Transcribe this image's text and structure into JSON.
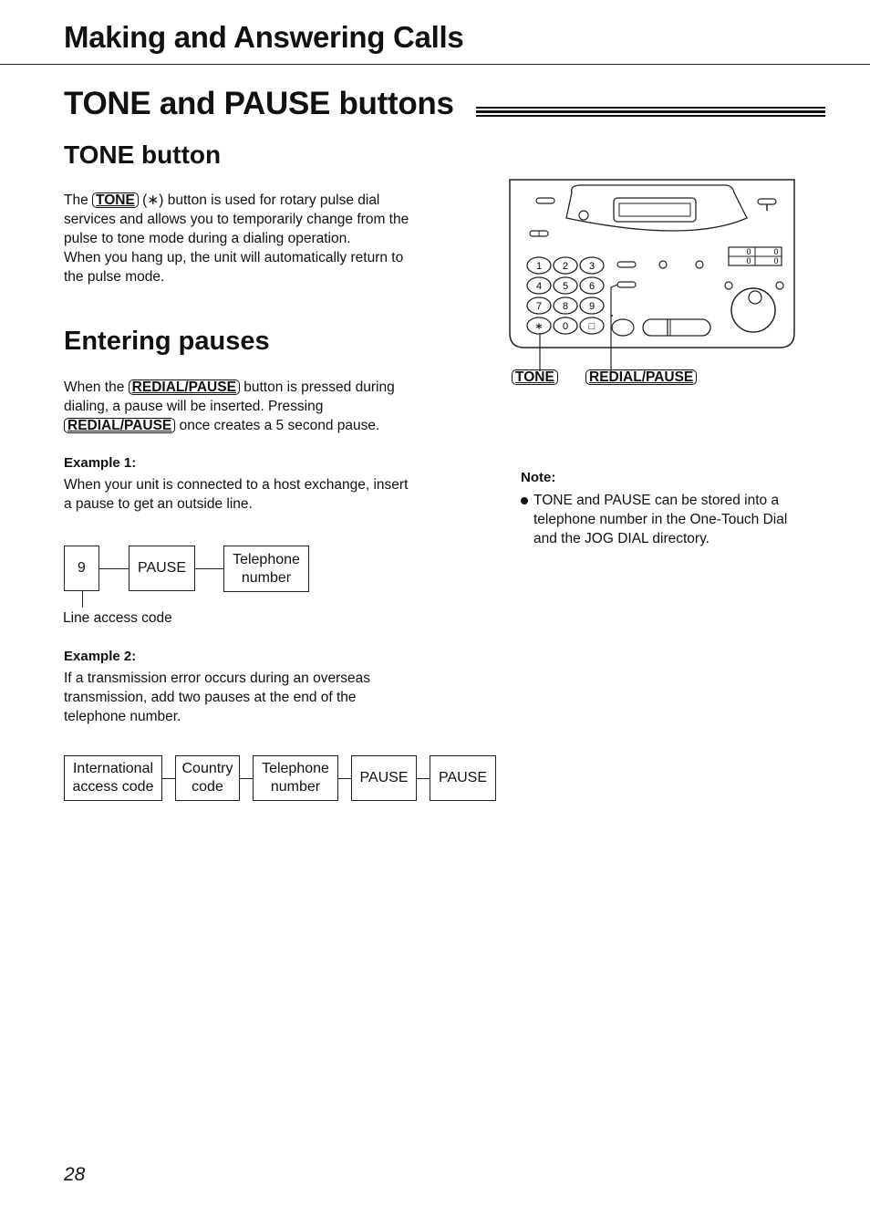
{
  "header": {
    "chapter_title": "Making and Answering Calls"
  },
  "section": {
    "title": "TONE and PAUSE buttons"
  },
  "tone_button": {
    "heading": "TONE button",
    "para_prefix": "The",
    "key_label": "TONE",
    "symbol": "(∗)",
    "para_rest_line1": "button is used for rotary pulse dial",
    "para_lines": [
      "services and allows you to temporarily change from the",
      "pulse to tone mode during a dialing operation.",
      "When you hang up, the unit will automatically return to",
      "the pulse mode."
    ]
  },
  "entering_pauses": {
    "heading": "Entering pauses",
    "line1_prefix": "When the",
    "key_label": "REDIAL/PAUSE",
    "line1_rest": "button is pressed during",
    "line2": "dialing, a pause will be inserted. Pressing",
    "line3_rest": "once creates a 5 second pause."
  },
  "example1": {
    "label": "Example 1:",
    "lines": [
      "When your unit is connected to a host exchange, insert",
      "a pause to get an outside line."
    ],
    "diagram": {
      "boxes": [
        "9",
        "PAUSE",
        "Telephone number"
      ],
      "caption": "Line access code"
    }
  },
  "example2": {
    "label": "Example 2:",
    "lines": [
      "If a transmission error occurs during an overseas",
      "transmission, add two pauses at the end of the",
      "telephone number."
    ],
    "diagram": {
      "boxes": [
        "International access code",
        "Country code",
        "Telephone number",
        "PAUSE",
        "PAUSE"
      ]
    }
  },
  "device_illustration": {
    "keypad": [
      "1",
      "2",
      "3",
      "4",
      "5",
      "6",
      "7",
      "8",
      "9",
      "∗",
      "0",
      "□"
    ],
    "counter_digits": [
      "0",
      "0",
      "0",
      "0"
    ],
    "callouts": [
      "TONE",
      "REDIAL/PAUSE"
    ]
  },
  "note": {
    "label": "Note:",
    "bullet_lines": [
      "TONE and PAUSE can be stored into a",
      "telephone number in the One-Touch Dial",
      "and the JOG DIAL directory."
    ]
  },
  "footer": {
    "page_number": "28"
  }
}
